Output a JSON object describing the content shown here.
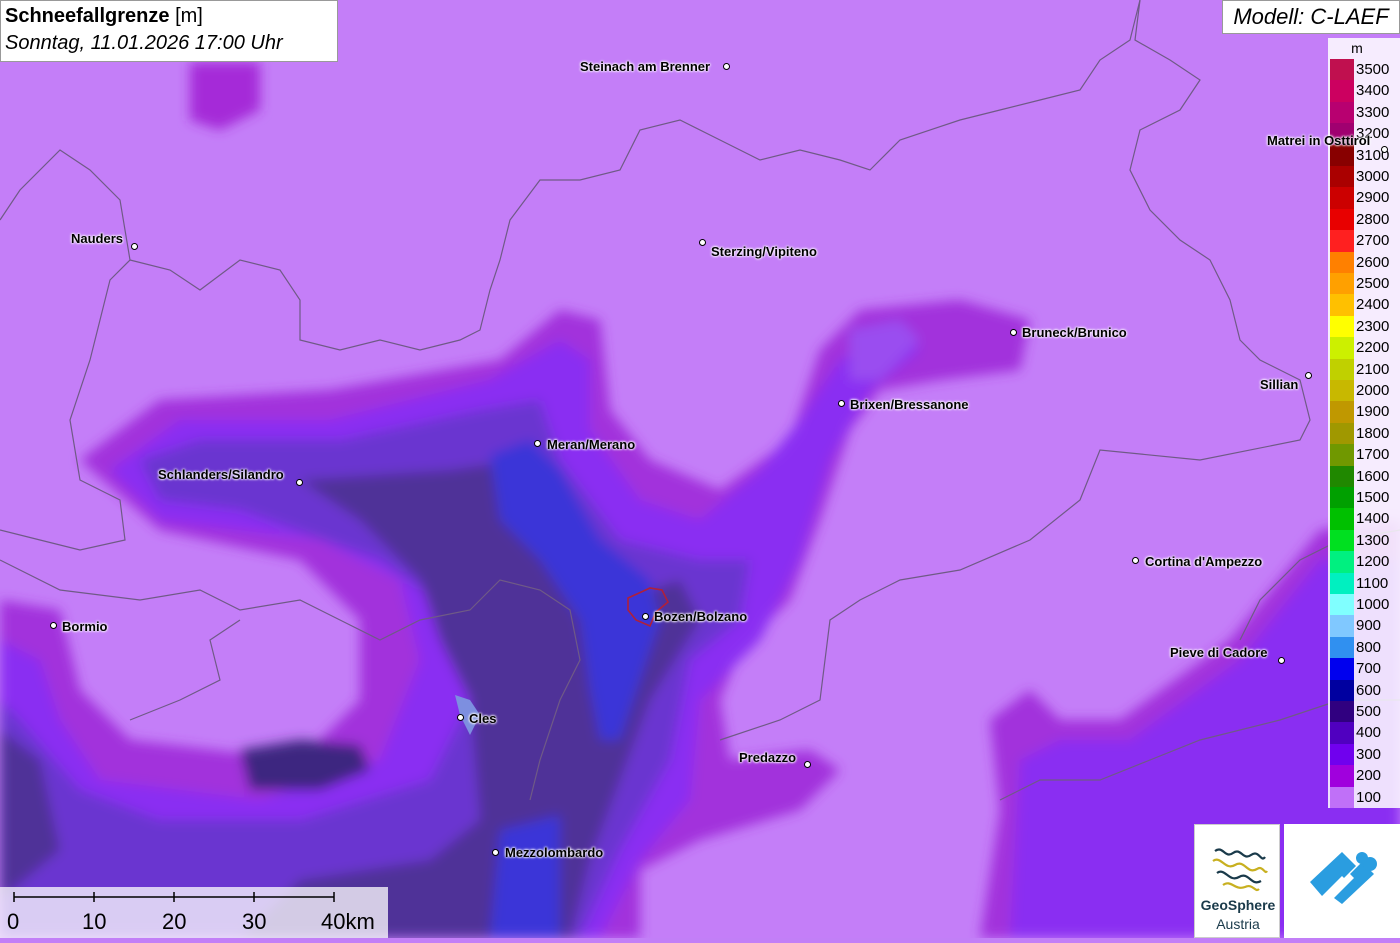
{
  "title": {
    "main": "Schneefallgrenze",
    "unit": "[m]",
    "datetime": "Sonntag, 11.01.2026 17:00 Uhr"
  },
  "model": "Modell: C-LAEF",
  "legend": {
    "unit": "m",
    "entries": [
      {
        "label": "3500",
        "color": "#c0104f"
      },
      {
        "label": "3400",
        "color": "#cc0060"
      },
      {
        "label": "3300",
        "color": "#b80070"
      },
      {
        "label": "3200",
        "color": "#a00070"
      },
      {
        "label": "3100",
        "color": "#880000"
      },
      {
        "label": "3000",
        "color": "#aa0000"
      },
      {
        "label": "2900",
        "color": "#cc0000"
      },
      {
        "label": "2800",
        "color": "#e80000"
      },
      {
        "label": "2700",
        "color": "#ff2020"
      },
      {
        "label": "2600",
        "color": "#ff8000"
      },
      {
        "label": "2500",
        "color": "#ffa000"
      },
      {
        "label": "2400",
        "color": "#ffc000"
      },
      {
        "label": "2300",
        "color": "#ffff00"
      },
      {
        "label": "2200",
        "color": "#ccf000"
      },
      {
        "label": "2100",
        "color": "#c0d000"
      },
      {
        "label": "2000",
        "color": "#c8b800"
      },
      {
        "label": "1900",
        "color": "#c09800"
      },
      {
        "label": "1800",
        "color": "#a09800"
      },
      {
        "label": "1700",
        "color": "#709800"
      },
      {
        "label": "1600",
        "color": "#208800"
      },
      {
        "label": "1500",
        "color": "#00a000"
      },
      {
        "label": "1400",
        "color": "#00c000"
      },
      {
        "label": "1300",
        "color": "#00e020"
      },
      {
        "label": "1200",
        "color": "#00f080"
      },
      {
        "label": "1100",
        "color": "#00f0c0"
      },
      {
        "label": "1000",
        "color": "#80ffff"
      },
      {
        "label": "900",
        "color": "#80c8ff"
      },
      {
        "label": "800",
        "color": "#3090f0"
      },
      {
        "label": "700",
        "color": "#0000ee"
      },
      {
        "label": "600",
        "color": "#0000a0"
      },
      {
        "label": "500",
        "color": "#300080"
      },
      {
        "label": "400",
        "color": "#5000c0"
      },
      {
        "label": "300",
        "color": "#7000ee"
      },
      {
        "label": "200",
        "color": "#a000dd"
      },
      {
        "label": "100",
        "color": "#c070f8"
      }
    ]
  },
  "cities": [
    {
      "name": "Steinach am Brenner"
    },
    {
      "name": "Nauders"
    },
    {
      "name": "Sterzing/Vipiteno"
    },
    {
      "name": "Matrei in Osttirol"
    },
    {
      "name": "Bruneck/Brunico"
    },
    {
      "name": "Sillian"
    },
    {
      "name": "Brixen/Bressanone"
    },
    {
      "name": "Meran/Merano"
    },
    {
      "name": "Schlanders/Silandro"
    },
    {
      "name": "Cortina d'Ampezzo"
    },
    {
      "name": "Bormio"
    },
    {
      "name": "Bozen/Bolzano"
    },
    {
      "name": "Pieve di Cadore"
    },
    {
      "name": "Cles"
    },
    {
      "name": "Predazzo"
    },
    {
      "name": "Mezzolombardo"
    }
  ],
  "scale_bar": {
    "labels": [
      "0",
      "10",
      "20",
      "30",
      "40km"
    ]
  },
  "logo": {
    "line1": "GeoSphere",
    "line2": "Austria"
  }
}
